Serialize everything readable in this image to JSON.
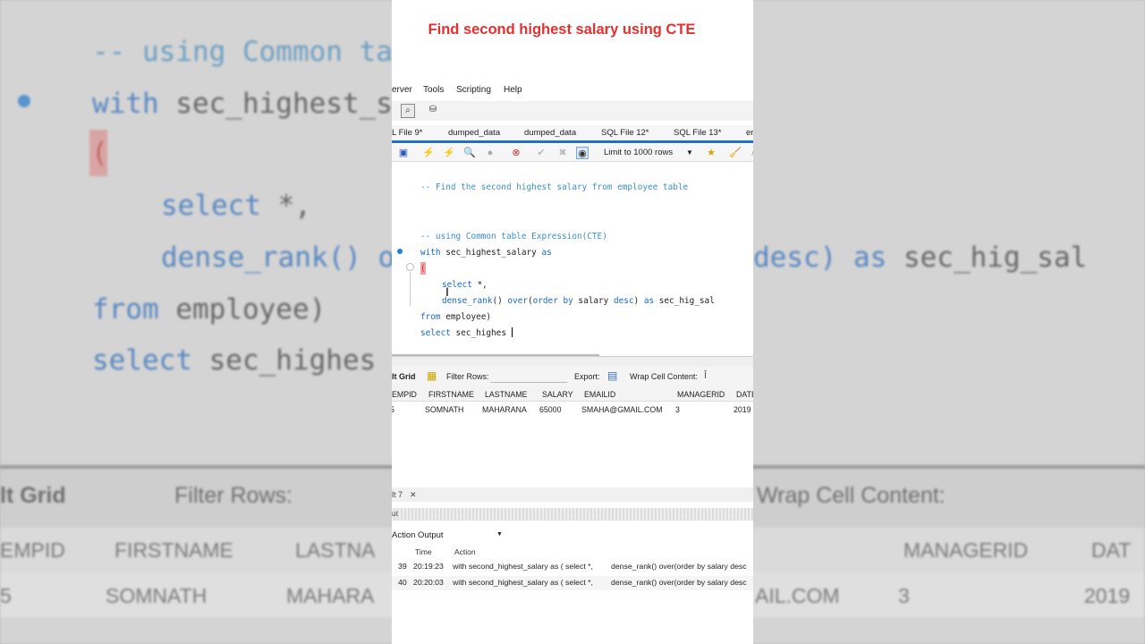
{
  "title": "Find second highest salary using CTE",
  "menu": [
    "erver",
    "Tools",
    "Scripting",
    "Help"
  ],
  "file_tabs": [
    "L File 9*",
    "dumped_data",
    "dumped_data",
    "SQL File 12*",
    "SQL File 13*",
    "er"
  ],
  "toolbar": {
    "limit_label": "Limit to 1000 rows"
  },
  "editor": {
    "line1": "-- Find the second highest salary from employee table",
    "line2": "-- using Common table Expression(CTE)",
    "line3a": "with",
    "line3b": " sec_highest_salary ",
    "line3c": "as",
    "line4": "(",
    "line5a": "select",
    "line5b": " *,",
    "line6a": "dense_rank",
    "line6b": "() ",
    "line6c": "over",
    "line6d": "(",
    "line6e": "order by",
    "line6f": " salary ",
    "line6g": "desc",
    "line6h": ") ",
    "line6i": "as",
    "line6j": " sec_hig_sal",
    "line7a": "from",
    "line7b": " employee)",
    "line8a": "select",
    "line8b": " sec_highes"
  },
  "result_toolbar": {
    "grid_label": "lt Grid",
    "filter_label": "Filter Rows:",
    "export_label": "Export:",
    "wrap_label": "Wrap Cell Content:"
  },
  "grid": {
    "headers": [
      "EMPID",
      "FIRSTNAME",
      "LASTNAME",
      "SALARY",
      "EMAILID",
      "MANAGERID",
      "DATE"
    ],
    "rows": [
      [
        "5",
        "SOMNATH",
        "MAHARANA",
        "65000",
        "SMAHA@GMAIL.COM",
        "3",
        "2019"
      ]
    ]
  },
  "output": {
    "tab_label": "lt 7",
    "side_label": "ut",
    "select_label": "Action Output",
    "headers": [
      "Time",
      "Action"
    ],
    "rows": [
      {
        "num": "39",
        "time": "20:19:23",
        "action": "with second_highest_salary as ( select *,",
        "action2": "dense_rank() over(order by salary desc"
      },
      {
        "num": "40",
        "time": "20:20:03",
        "action": "with second_highest_salary as ( select *,",
        "action2": "dense_rank() over(order by salary desc"
      }
    ]
  },
  "background": {
    "code1": "-- using Common ta",
    "code2a": "with",
    "code2b": " sec_highest_s",
    "code3": "(",
    "code4a": "select",
    "code4b": " *,",
    "code5": "dense_rank() o",
    "code5r_a": "desc) ",
    "code5r_b": "as",
    "code5r_c": " sec_hig_sal",
    "code6a": "from",
    "code6b": " employee)",
    "code7a": "select",
    "code7b": " sec_highes",
    "grid_label": "lt Grid",
    "filter_label": "Filter Rows:",
    "wrap_label": "Wrap Cell Content:",
    "h_empid": "EMPID",
    "h_first": "FIRSTNAME",
    "h_last": "LASTNA",
    "h_mgr": "MANAGERID",
    "h_date": "DAT",
    "r_emp": "5",
    "r_first": "SOMNATH",
    "r_last": "MAHARA",
    "r_email": "AIL.COM",
    "r_mgr": "3",
    "r_date": "2019"
  }
}
